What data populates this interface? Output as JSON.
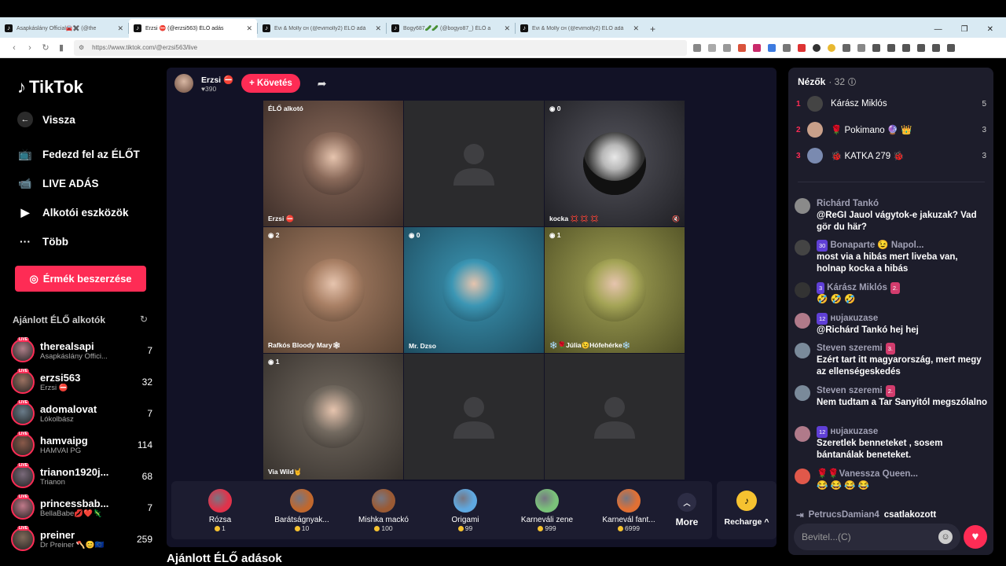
{
  "browser": {
    "tabs": [
      {
        "title": "Asapkáslány Official🚘✖️ (@the",
        "active": false
      },
      {
        "title": "Erzsi ⛔ (@erzsi563) ÉLŐ adás",
        "active": true
      },
      {
        "title": "Évi & Molly сн (@evimolly2) ÉLŐ adá",
        "active": false
      },
      {
        "title": "Bogy687🥒🥒 (@bogyo87_) ÉLŐ a",
        "active": false
      },
      {
        "title": "Évi & Molly сн (@evimolly2) ÉLŐ adá",
        "active": false
      }
    ],
    "new_tab": "+",
    "url": "https://www.tiktok.com/@erzsi563/live"
  },
  "sidebar": {
    "logo": "TikTok",
    "back": "Vissza",
    "nav": [
      {
        "label": "Fedezd fel az ÉLŐT",
        "icon": "live-tv-icon"
      },
      {
        "label": "LIVE ADÁS",
        "icon": "video-camera-icon"
      },
      {
        "label": "Alkotói eszközök",
        "icon": "creator-tools-icon"
      },
      {
        "label": "Több",
        "icon": "more-dots-icon"
      }
    ],
    "coins_button": "Érmék beszerzése",
    "recommended_title": "Ajánlott ÉLŐ alkotók",
    "recommended": [
      {
        "name": "therealsapi",
        "sub": "Asapkáslány Offici...",
        "count": "7"
      },
      {
        "name": "erzsi563",
        "sub": "Erzsi ⛔",
        "count": "32"
      },
      {
        "name": "adomalovat",
        "sub": "Lókolbász",
        "count": "7"
      },
      {
        "name": "hamvaipg",
        "sub": "HAMVAI PG",
        "count": "114"
      },
      {
        "name": "trianon1920j...",
        "sub": "Trianon",
        "count": "68"
      },
      {
        "name": "princessbab...",
        "sub": "BellaBabe💋❤️🦎",
        "count": "7"
      },
      {
        "name": "preiner",
        "sub": "Dr Preiner 🪓😊🇪🇺",
        "count": "259"
      }
    ],
    "live_tag": "LIVE"
  },
  "host": {
    "name": "Erzsi ⛔",
    "likes": "♥390",
    "follow": "+ Követés"
  },
  "grid": [
    {
      "badge": "ÉLŐ alkotó",
      "label": "Erzsi ⛔",
      "kind": "person",
      "colors": [
        "#8a6a5a",
        "#3c2d28"
      ]
    },
    {
      "badge": "",
      "label": "",
      "kind": "empty"
    },
    {
      "badge": "◉ 0",
      "label": "kocka 💢 💢 💢",
      "kind": "clown",
      "colors": [
        "#54545c",
        "#1f1f24"
      ]
    },
    {
      "badge": "◉ 2",
      "label": "Rafkós Bloody Mary🕸",
      "kind": "person",
      "colors": [
        "#a98065",
        "#5a4434"
      ]
    },
    {
      "badge": "◉ 0",
      "label": "Mr. Dzso",
      "kind": "person",
      "colors": [
        "#3b96b4",
        "#1e4d60"
      ]
    },
    {
      "badge": "◉ 1",
      "label": "❄️🌹Júlia😉Hófehérke❄️",
      "kind": "person",
      "colors": [
        "#a4a456",
        "#505025"
      ]
    },
    {
      "badge": "◉ 1",
      "label": "Via Wild🤘",
      "kind": "person",
      "colors": [
        "#736a60",
        "#35302c"
      ]
    },
    {
      "badge": "",
      "label": "",
      "kind": "empty"
    },
    {
      "badge": "",
      "label": "",
      "kind": "empty"
    }
  ],
  "gifts": [
    {
      "name": "Rózsa",
      "price": "1",
      "color": "#e0334b"
    },
    {
      "name": "Barátságnyak...",
      "price": "10",
      "color": "#c0682e"
    },
    {
      "name": "Mishka mackó",
      "price": "100",
      "color": "#9a5a34"
    },
    {
      "name": "Origami",
      "price": "99",
      "color": "#5fa8e0"
    },
    {
      "name": "Karneváli zene",
      "price": "999",
      "color": "#7ac27a"
    },
    {
      "name": "Karnevál fant...",
      "price": "6999",
      "color": "#e07034"
    }
  ],
  "more_label": "More",
  "recharge_label": "Recharge ^",
  "section_title": "Ajánlott ÉLŐ adások",
  "chat": {
    "viewers_label": "Nézők",
    "viewers_count": "· 32",
    "top_viewers": [
      {
        "rank": "1",
        "name": "Kárász Miklós",
        "score": "5"
      },
      {
        "rank": "2",
        "name": "🌹 Pokimano 🔮 👑",
        "score": "3"
      },
      {
        "rank": "3",
        "name": "🐞 KATKA 279 🐞",
        "score": "3"
      }
    ],
    "messages": [
      {
        "user": "Richárd Tankó",
        "badge": "",
        "badge2": "",
        "text": "@ReGI Jauol vágytok-e jakuzak? Vad gör du här?"
      },
      {
        "user": "Bonaparte 😉 Napol...",
        "badge": "30",
        "badge2": "",
        "text": "most via a hibás mert liveba van, holnap kocka a hibás"
      },
      {
        "user": "Kárász Miklós",
        "badge": "3",
        "badge2": "2.",
        "text": "🤣 🤣 🤣"
      },
      {
        "user": "нυjaкuzaѕe",
        "badge": "12",
        "badge2": "",
        "text": "@Richárd Tankó hej hej"
      },
      {
        "user": "Steven szeremi",
        "badge": "",
        "badge2": "3.",
        "text": "Ezért tart itt magyarország, mert megy az ellenségeskedés"
      },
      {
        "user": "Steven szeremi",
        "badge": "",
        "badge2": "2.",
        "text": "Nem tudtam a Tar Sanyitól megszólalno"
      },
      {
        "user": "нυjaкuzaѕe",
        "badge": "12",
        "badge2": "",
        "text": "Szeretlek benneteket , sosem bántanálak beneteket."
      },
      {
        "user": "🌹🌹Vanessza Queen...",
        "badge": "",
        "badge2": "",
        "text": "😂 😂 😂 😂"
      }
    ],
    "joined_user": "PetrucsDamian4",
    "joined_text": "csatlakozott",
    "input_placeholder": "Bevitel...(C)"
  }
}
